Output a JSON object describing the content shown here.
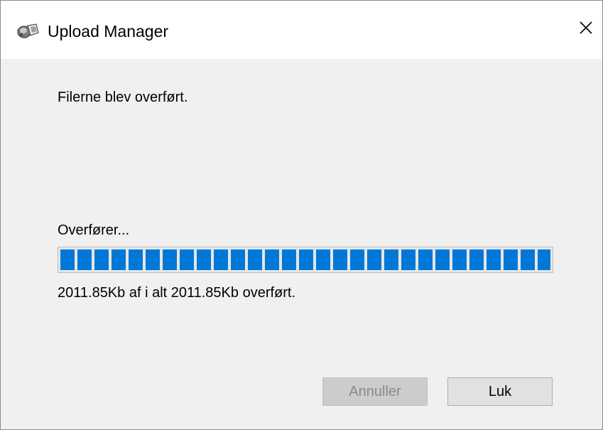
{
  "window": {
    "title": "Upload Manager",
    "app_icon": "upload-manager-icon",
    "close_icon": "close-icon"
  },
  "dialog": {
    "status_message": "Filerne blev overført.",
    "transfer_label": "Overfører...",
    "progress": {
      "fraction": 1.0,
      "transferred": "2011.85Kb",
      "total": "2011.85Kb"
    },
    "bytes_text": "2011.85Kb af i alt 2011.85Kb overført."
  },
  "buttons": {
    "cancel_label": "Annuller",
    "cancel_enabled": false,
    "close_label": "Luk",
    "close_enabled": true
  },
  "colors": {
    "progress_fill": "#0078d7",
    "dialog_background": "#f0f0f0",
    "disabled_text": "#8a8a8a"
  }
}
